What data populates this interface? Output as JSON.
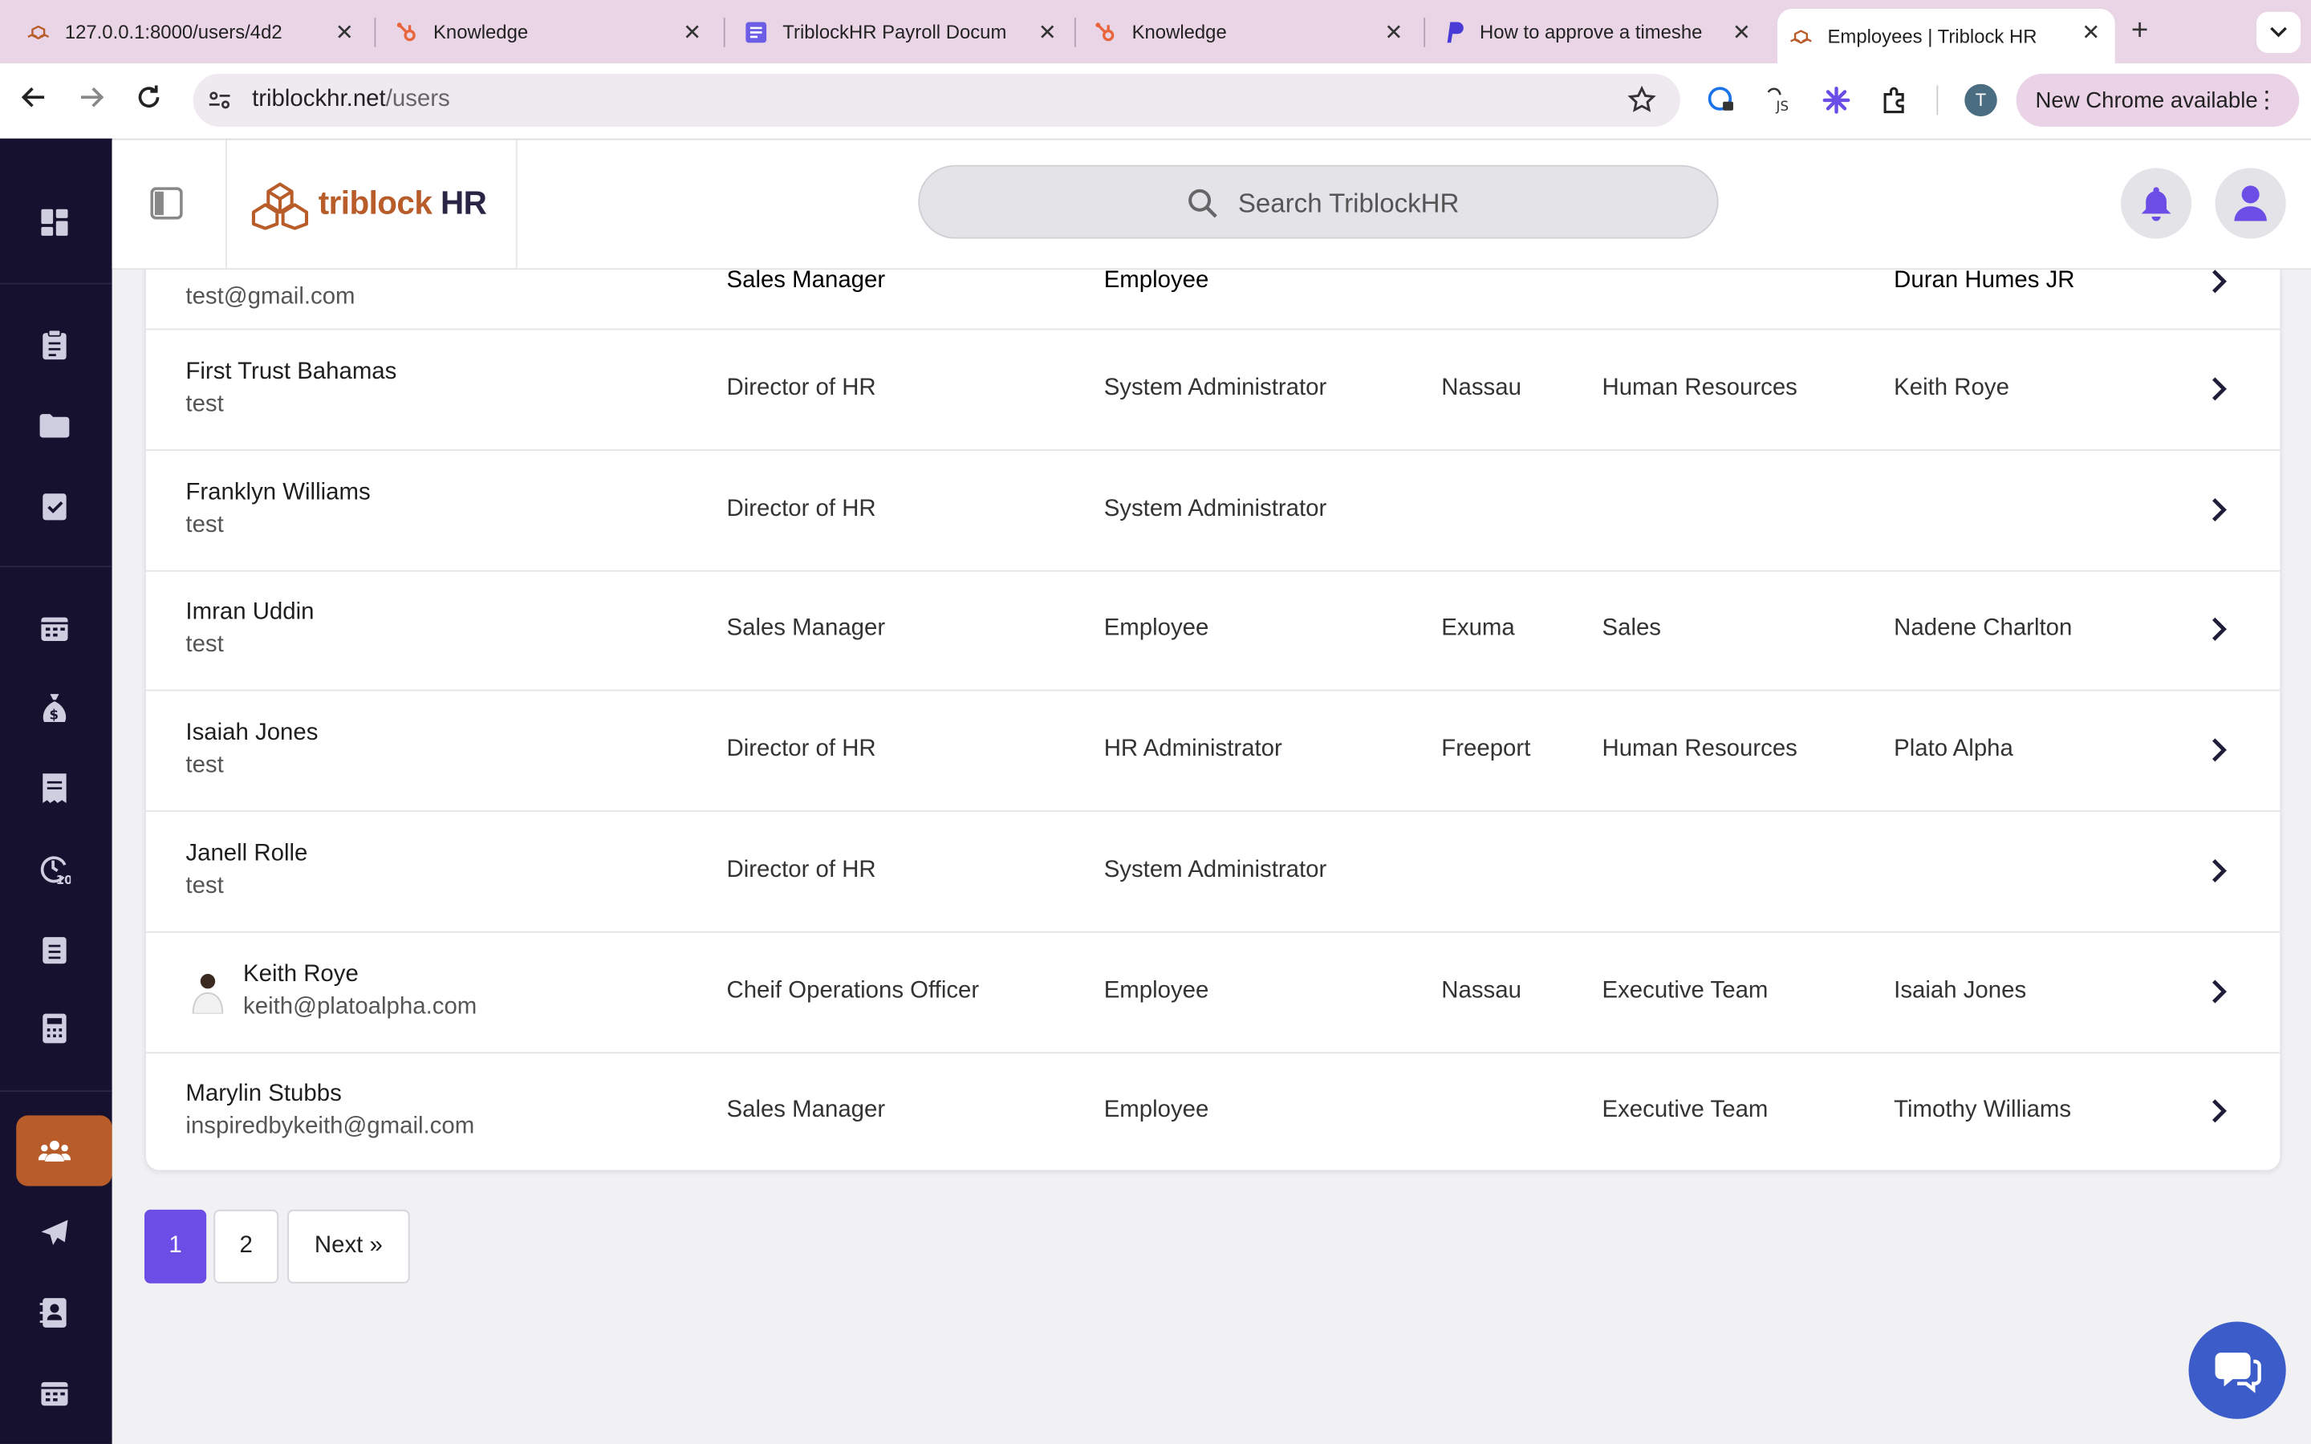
{
  "browser": {
    "tabs": [
      {
        "title": "127.0.0.1:8000/users/4d2",
        "icon": "triblock-logo-icon"
      },
      {
        "title": "Knowledge",
        "icon": "hubspot-icon"
      },
      {
        "title": "TriblockHR Payroll Docum",
        "icon": "docs-icon"
      },
      {
        "title": "Knowledge",
        "icon": "hubspot-icon"
      },
      {
        "title": "How to approve a timeshe",
        "icon": "paypal-icon"
      },
      {
        "title": "Employees | Triblock HR",
        "icon": "triblock-logo-icon"
      }
    ],
    "url_host": "triblockhr.net",
    "url_path": "/users",
    "profile_initial": "T",
    "update_label": "New Chrome available"
  },
  "header": {
    "logo_primary": "triblock",
    "logo_secondary": "HR",
    "search_placeholder": "Search TriblockHR"
  },
  "table": {
    "partial_row": {
      "name": "",
      "sub": "test@gmail.com",
      "title": "Sales Manager",
      "role": "Employee",
      "location": "",
      "department": "",
      "manager": "Duran Humes JR"
    },
    "rows": [
      {
        "name": "First Trust Bahamas",
        "sub": "test",
        "title": "Director of HR",
        "role": "System Administrator",
        "location": "Nassau",
        "department": "Human Resources",
        "manager": "Keith Roye",
        "has_avatar": false
      },
      {
        "name": "Franklyn Williams",
        "sub": "test",
        "title": "Director of HR",
        "role": "System Administrator",
        "location": "",
        "department": "",
        "manager": "",
        "has_avatar": false
      },
      {
        "name": "Imran Uddin",
        "sub": "test",
        "title": "Sales Manager",
        "role": "Employee",
        "location": "Exuma",
        "department": "Sales",
        "manager": "Nadene Charlton",
        "has_avatar": false
      },
      {
        "name": "Isaiah Jones",
        "sub": "test",
        "title": "Director of HR",
        "role": "HR Administrator",
        "location": "Freeport",
        "department": "Human Resources",
        "manager": "Plato Alpha",
        "has_avatar": false
      },
      {
        "name": "Janell Rolle",
        "sub": "test",
        "title": "Director of HR",
        "role": "System Administrator",
        "location": "",
        "department": "",
        "manager": "",
        "has_avatar": false
      },
      {
        "name": "Keith Roye",
        "sub": "keith@platoalpha.com",
        "title": "Cheif Operations Officer",
        "role": "Employee",
        "location": "Nassau",
        "department": "Executive Team",
        "manager": "Isaiah Jones",
        "has_avatar": true
      },
      {
        "name": "Marylin Stubbs",
        "sub": "inspiredbykeith@gmail.com",
        "title": "Sales Manager",
        "role": "Employee",
        "location": "",
        "department": "Executive Team",
        "manager": "Timothy Williams",
        "has_avatar": false
      }
    ]
  },
  "pagination": {
    "pages": [
      "1",
      "2"
    ],
    "current": "1",
    "next_label": "Next »"
  },
  "colors": {
    "accent": "#6c4ee6",
    "brand": "#b85c2a",
    "sidebar": "#16112e"
  }
}
